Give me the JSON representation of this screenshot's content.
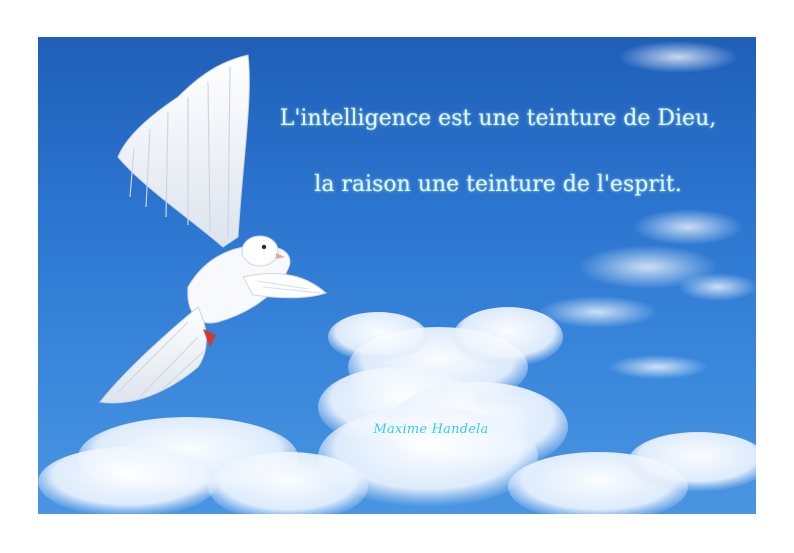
{
  "image": {
    "subject": "white-dove-in-blue-sky",
    "colors": {
      "sky_top": "#1f5fb8",
      "sky_bottom": "#4a95e2",
      "quote_text": "#dff7ff",
      "author_text": "#30c8ff",
      "frame": "#ffffff"
    }
  },
  "quote": {
    "line1": "L'intelligence est une teinture de Dieu,",
    "line2": "la raison une teinture de l'esprit."
  },
  "author": {
    "name": "Maxime Handela"
  }
}
